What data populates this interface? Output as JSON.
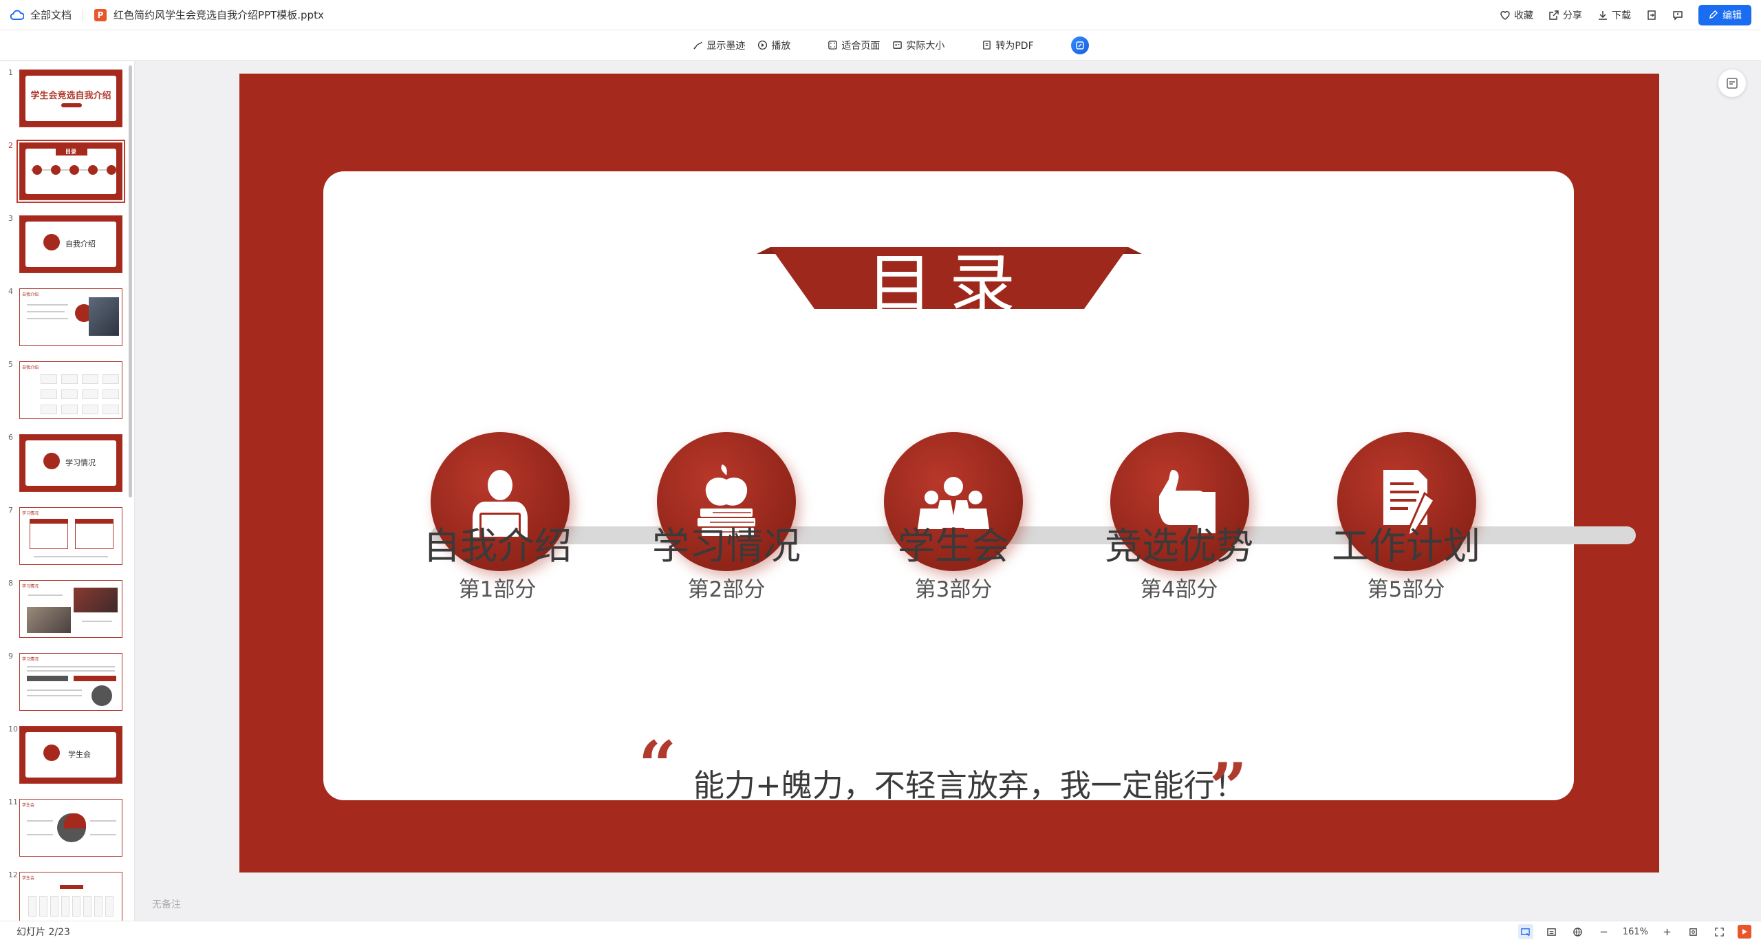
{
  "topbar": {
    "all_docs": "全部文档",
    "file_name": "红色简约风学生会竞选自我介绍PPT模板.pptx",
    "ppt_badge": "P",
    "actions": {
      "favorite": "收藏",
      "share": "分享",
      "download": "下载"
    },
    "edit": "编辑"
  },
  "toolbar": {
    "show_ink": "显示墨迹",
    "play": "播放",
    "fit_page": "适合页面",
    "actual_size": "实际大小",
    "to_pdf": "转为PDF"
  },
  "sidebar": {
    "thumbs": [
      {
        "num": "1",
        "title": "学生会竞选自我介绍"
      },
      {
        "num": "2",
        "title": "目录"
      },
      {
        "num": "3",
        "title": "自我介绍"
      },
      {
        "num": "4",
        "title": "自我介绍"
      },
      {
        "num": "5",
        "title": "自我介绍"
      },
      {
        "num": "6",
        "title": "学习情况"
      },
      {
        "num": "7",
        "title": "学习情况"
      },
      {
        "num": "8",
        "title": "学习情况"
      },
      {
        "num": "9",
        "title": "学习情况"
      },
      {
        "num": "10",
        "title": "学生会"
      },
      {
        "num": "11",
        "title": "学生会"
      },
      {
        "num": "12",
        "title": "学生会"
      }
    ]
  },
  "slide": {
    "heading": "目录",
    "sections": [
      {
        "title": "自我介绍",
        "sub": "第1部分",
        "icon": "person-laptop-icon"
      },
      {
        "title": "学习情况",
        "sub": "第2部分",
        "icon": "apple-books-icon"
      },
      {
        "title": "学生会",
        "sub": "第3部分",
        "icon": "group-icon"
      },
      {
        "title": "竞选优势",
        "sub": "第4部分",
        "icon": "thumbs-up-icon"
      },
      {
        "title": "工作计划",
        "sub": "第5部分",
        "icon": "document-pen-icon"
      }
    ],
    "quote": "能力+魄力，不轻言放弃，我一定能行！",
    "quote_open": "“",
    "quote_close": "”"
  },
  "notes": "无备注",
  "status": {
    "slide_count": "幻灯片 2/23",
    "zoom": "161%"
  },
  "colors": {
    "slide_red": "#a52a1d",
    "accent_blue": "#1a6cf0"
  }
}
